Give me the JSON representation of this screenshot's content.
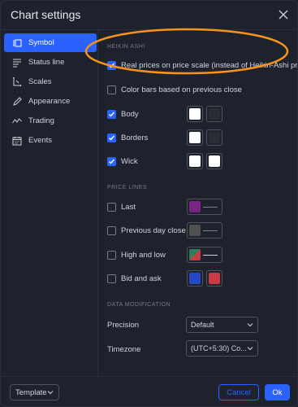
{
  "header": {
    "title": "Chart settings"
  },
  "sidebar": {
    "items": [
      {
        "label": "Symbol",
        "icon": "symbol-icon",
        "active": true
      },
      {
        "label": "Status line",
        "icon": "status-line-icon"
      },
      {
        "label": "Scales",
        "icon": "scales-icon"
      },
      {
        "label": "Appearance",
        "icon": "pencil-icon"
      },
      {
        "label": "Trading",
        "icon": "trading-icon"
      },
      {
        "label": "Events",
        "icon": "calendar-icon"
      }
    ]
  },
  "heikin": {
    "section_title": "HEIKIN ASHI",
    "real_prices_label": "Real prices on price scale (instead of Heikin-Ashi price)",
    "real_prices_checked": true,
    "color_bars_label": "Color bars based on previous close",
    "color_bars_checked": false,
    "body_label": "Body",
    "body_checked": true,
    "body_colors": [
      "#ffffff",
      "#2b2d33"
    ],
    "borders_label": "Borders",
    "borders_checked": true,
    "borders_colors": [
      "#ffffff",
      "#2b2d33"
    ],
    "wick_label": "Wick",
    "wick_checked": true,
    "wick_colors": [
      "#ffffff",
      "#ffffff"
    ]
  },
  "price_lines": {
    "section_title": "PRICE LINES",
    "last_label": "Last",
    "last_color": "#7b2486",
    "prev_close_label": "Previous day close",
    "prev_close_color": "#505050",
    "high_low_label": "High and low",
    "bid_ask_label": "Bid and ask",
    "bid_color": "#2549c6",
    "ask_color": "#c93a43"
  },
  "data_mod": {
    "section_title": "DATA MODIFICATION",
    "precision_label": "Precision",
    "precision_value": "Default",
    "timezone_label": "Timezone",
    "timezone_value": "(UTC+5:30) Co..."
  },
  "footer": {
    "template_label": "Template",
    "cancel_label": "Cancel",
    "ok_label": "Ok"
  },
  "colors": {
    "accent": "#2962ff",
    "annotation": "#f7931a",
    "background": "#1e222d"
  }
}
